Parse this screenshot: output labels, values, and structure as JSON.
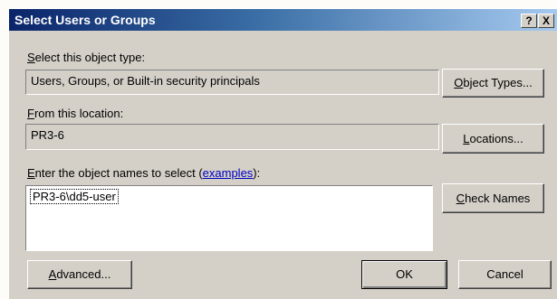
{
  "window": {
    "title": "Select Users or Groups",
    "help_glyph": "?",
    "close_glyph": "X"
  },
  "object_type": {
    "label_prefix": "S",
    "label_rest": "elect this object type:",
    "value": "Users, Groups, or Built-in security principals",
    "button_prefix": "O",
    "button_rest": "bject Types..."
  },
  "location": {
    "label_prefix": "F",
    "label_rest": "rom this location:",
    "value": "PR3-6",
    "button_prefix": "L",
    "button_rest": "ocations..."
  },
  "names": {
    "label_prefix": "E",
    "label_rest": "nter the object names to select (",
    "examples_link": "examples",
    "label_suffix": "):",
    "value": "PR3-6\\dd5-user",
    "check_prefix": "C",
    "check_rest": "heck Names"
  },
  "footer": {
    "advanced_prefix": "A",
    "advanced_rest": "dvanced...",
    "ok_label": "OK",
    "cancel_label": "Cancel"
  }
}
